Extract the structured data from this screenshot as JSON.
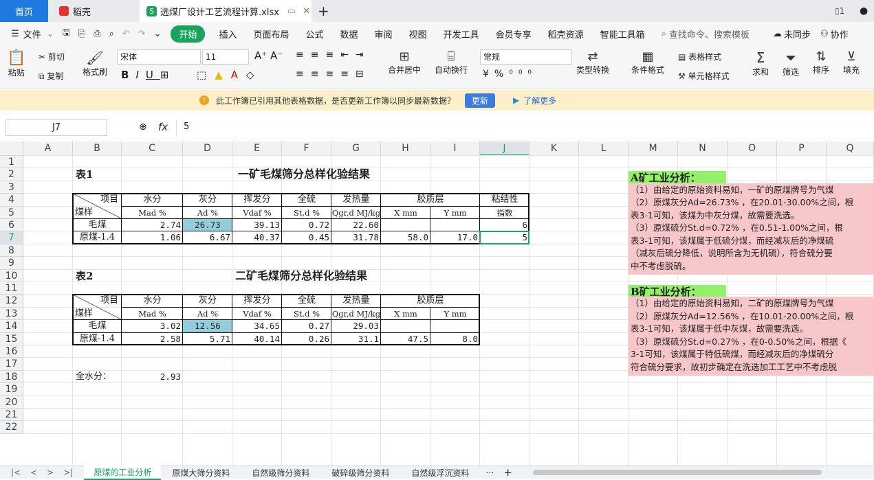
{
  "tabs": {
    "home": "首页",
    "daoke": "稻壳",
    "file": "选煤厂设计工艺流程计算.xlsx",
    "s_icon": "S"
  },
  "menu": {
    "file": "文件",
    "start": "开始",
    "items": [
      "插入",
      "页面布局",
      "公式",
      "数据",
      "审阅",
      "视图",
      "开发工具",
      "会员专享",
      "稻壳资源",
      "智能工具箱"
    ],
    "search": "查找命令、搜索模板",
    "sync": "未同步",
    "collab": "协作"
  },
  "ribbon": {
    "paste": "粘贴",
    "cut": "剪切",
    "copy": "复制",
    "format_painter": "格式刷",
    "font": "宋体",
    "size": "11",
    "merge": "合并居中",
    "wrap": "自动换行",
    "numfmt": "常规",
    "convert": "类型转换",
    "cond": "条件格式",
    "table_style": "表格样式",
    "cell_style": "单元格样式",
    "sum": "求和",
    "filter": "筛选",
    "sort": "排序",
    "fill": "填充"
  },
  "notice": {
    "text": "此工作簿已引用其他表格数据，是否更新工作簿以同步最新数据？",
    "update": "更新",
    "learn": "了解更多"
  },
  "formula": {
    "ref": "J7",
    "fx": "fx",
    "value": "5"
  },
  "cols": [
    "A",
    "B",
    "C",
    "D",
    "E",
    "F",
    "G",
    "H",
    "I",
    "J",
    "K",
    "L",
    "M",
    "N",
    "O",
    "P",
    "Q"
  ],
  "rows": [
    "1",
    "2",
    "3",
    "4",
    "5",
    "6",
    "7",
    "8",
    "9",
    "10",
    "11",
    "12",
    "13",
    "14",
    "15",
    "16",
    "17",
    "18",
    "19",
    "20",
    "21",
    "22"
  ],
  "t1": {
    "label": "表1",
    "title": "一矿毛煤筛分总样化验结果",
    "item": "项目",
    "coal": "煤样",
    "h": [
      "水分",
      "灰分",
      "挥发分",
      "全硫",
      "发热量",
      "胶质层",
      "粘结性"
    ],
    "s": [
      "Mad %",
      "Ad %",
      "Vdaf %",
      "St,d %",
      "Qgr,d MJ/kg",
      "X mm",
      "Y mm",
      "指数"
    ],
    "r1": [
      "毛煤",
      "2.74",
      "26.73",
      "39.13",
      "0.72",
      "22.60",
      "",
      "",
      "6"
    ],
    "r2": [
      "原煤-1.4",
      "1.06",
      "6.67",
      "40.37",
      "0.45",
      "31.78",
      "58.0",
      "17.0",
      "5"
    ]
  },
  "t2": {
    "label": "表2",
    "title": "二矿毛煤筛分总样化验结果",
    "item": "项目",
    "coal": "煤样",
    "h": [
      "水分",
      "灰分",
      "挥发分",
      "全硫",
      "发热量",
      "胶质层"
    ],
    "s": [
      "Mad %",
      "Ad %",
      "Vdaf %",
      "St,d %",
      "Qgr,d MJ/kg",
      "X mm",
      "Y mm"
    ],
    "r1": [
      "毛煤",
      "3.02",
      "12.56",
      "34.65",
      "0.27",
      "29.03",
      "",
      ""
    ],
    "r2": [
      "原煤-1.4",
      "2.58",
      "5.71",
      "40.14",
      "0.26",
      "31.1",
      "47.5",
      "8.0"
    ]
  },
  "total_water": {
    "label": "全水分：",
    "value": "2.93"
  },
  "a": {
    "title": "A矿工业分析：",
    "lines": [
      "（1）由给定的原始资料易知，一矿的原煤牌号为气煤",
      "（2）原煤灰分Ad=26.73% ，在20.01-30.00%之间，根",
      "表3-1可知，该煤为中灰分煤，故需要洗选。",
      "（3）原煤硫分St.d=0.72% ，在0.51-1.00%之间，根",
      "表3-1可知，该煤属于低硫分煤，而经减灰后的净煤硫",
      "（减灰后硫分降低，说明所含为无机硫），符合硫分要",
      "中不考虑脱硫。"
    ]
  },
  "b": {
    "title": "B矿工业分析：",
    "lines": [
      "（1）由给定的原始资料易知，二矿的原煤牌号为气煤",
      "（2）原煤灰分Ad=12.56% ，在10.01-20.00%之间，根",
      "表3-1可知，该煤属于低中灰煤，故需要洗选。",
      "（3）原煤硫分St.d=0.27% ，在0-0.50%之间，根据《",
      "3-1可知，该煤属于特低硫煤，而经减灰后的净煤硫分",
      "符合硫分要求，故初步确定在洗选加工工艺中不考虑脱"
    ]
  },
  "sheets": [
    "原煤的工业分析",
    "原煤大筛分资料",
    "自然级筛分资料",
    "破碎级筛分资料",
    "自然级浮沉资料"
  ],
  "colors": {
    "accent": "#1aa35c",
    "highlight": "#92cddc",
    "note": "#f7c6c8",
    "note_title": "#92f06a"
  }
}
